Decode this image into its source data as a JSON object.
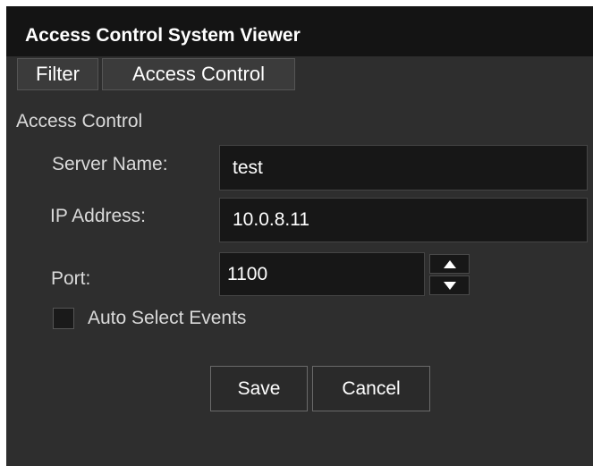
{
  "window": {
    "title": "Access Control System Viewer"
  },
  "tabs": [
    {
      "label": "Filter"
    },
    {
      "label": "Access Control"
    }
  ],
  "section": {
    "heading": "Access Control"
  },
  "form": {
    "server_name": {
      "label": "Server Name:",
      "value": "test"
    },
    "ip_address": {
      "label": "IP Address:",
      "value": "10.0.8.11"
    },
    "port": {
      "label": "Port:",
      "value": "1100"
    },
    "auto_select": {
      "label": "Auto Select Events",
      "checked": false
    }
  },
  "buttons": {
    "save": "Save",
    "cancel": "Cancel"
  },
  "icons": {
    "spin_up": "triangle-up-icon",
    "spin_down": "triangle-down-icon"
  },
  "colors": {
    "background": "#2e2e2e",
    "titlebar": "#141414",
    "field": "#171717",
    "text": "#ffffff",
    "label": "#dadada"
  }
}
